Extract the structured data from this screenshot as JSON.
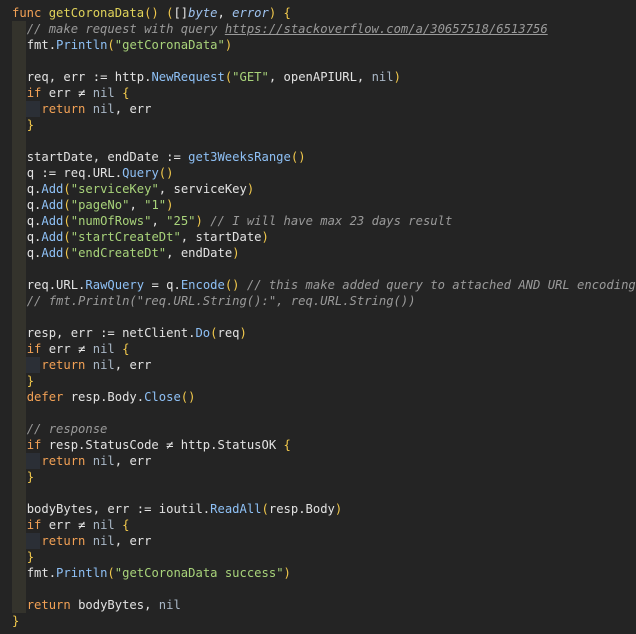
{
  "editor": {
    "language": "Go",
    "background": "#242424",
    "colors": {
      "keyword": "#f2a155",
      "function_name": "#e0d35a",
      "method_call": "#8ec0f5",
      "string": "#a8d37a",
      "comment": "#9a9a9a",
      "type": "#9fc3ef",
      "indent_guide_1": "#34332c",
      "indent_guide_2": "#2b2f36"
    },
    "lines": [
      {
        "indent": 0,
        "tokens": [
          [
            "kw",
            "func "
          ],
          [
            "fn",
            "getCoronaData"
          ],
          [
            "br",
            "() ("
          ],
          [
            "op",
            "[]"
          ],
          [
            "ty",
            "byte"
          ],
          [
            "op",
            ", "
          ],
          [
            "ty",
            "error"
          ],
          [
            "br",
            ") {"
          ]
        ]
      },
      {
        "indent": 1,
        "tokens": [
          [
            "cm",
            "// make request with query "
          ],
          [
            "url",
            "https://stackoverflow.com/a/30657518/6513756"
          ]
        ]
      },
      {
        "indent": 1,
        "tokens": [
          [
            "var",
            "fmt."
          ],
          [
            "call",
            "Println"
          ],
          [
            "br",
            "("
          ],
          [
            "str",
            "\"getCoronaData\""
          ],
          [
            "br",
            ")"
          ]
        ]
      },
      {
        "indent": 1,
        "tokens": []
      },
      {
        "indent": 1,
        "tokens": [
          [
            "var",
            "req, err "
          ],
          [
            "op",
            ":= "
          ],
          [
            "var",
            "http."
          ],
          [
            "call",
            "NewRequest"
          ],
          [
            "br",
            "("
          ],
          [
            "str",
            "\"GET\""
          ],
          [
            "op",
            ", "
          ],
          [
            "var",
            "openAPIURL, "
          ],
          [
            "nil",
            "nil"
          ],
          [
            "br",
            ")"
          ]
        ]
      },
      {
        "indent": 1,
        "tokens": [
          [
            "kw",
            "if "
          ],
          [
            "var",
            "err "
          ],
          [
            "op",
            "≠ "
          ],
          [
            "nil",
            "nil "
          ],
          [
            "br",
            "{"
          ]
        ]
      },
      {
        "indent": 2,
        "tokens": [
          [
            "kw",
            "return "
          ],
          [
            "nil",
            "nil"
          ],
          [
            "op",
            ", "
          ],
          [
            "var",
            "err"
          ]
        ]
      },
      {
        "indent": 1,
        "tokens": [
          [
            "br",
            "}"
          ]
        ]
      },
      {
        "indent": 1,
        "tokens": []
      },
      {
        "indent": 1,
        "tokens": [
          [
            "var",
            "startDate, endDate "
          ],
          [
            "op",
            ":= "
          ],
          [
            "call",
            "get3WeeksRange"
          ],
          [
            "br",
            "()"
          ]
        ]
      },
      {
        "indent": 1,
        "tokens": [
          [
            "var",
            "q "
          ],
          [
            "op",
            ":= "
          ],
          [
            "var",
            "req.URL."
          ],
          [
            "call",
            "Query"
          ],
          [
            "br",
            "()"
          ]
        ]
      },
      {
        "indent": 1,
        "tokens": [
          [
            "var",
            "q."
          ],
          [
            "call",
            "Add"
          ],
          [
            "br",
            "("
          ],
          [
            "str",
            "\"serviceKey\""
          ],
          [
            "op",
            ", "
          ],
          [
            "var",
            "serviceKey"
          ],
          [
            "br",
            ")"
          ]
        ]
      },
      {
        "indent": 1,
        "tokens": [
          [
            "var",
            "q."
          ],
          [
            "call",
            "Add"
          ],
          [
            "br",
            "("
          ],
          [
            "str",
            "\"pageNo\""
          ],
          [
            "op",
            ", "
          ],
          [
            "str",
            "\"1\""
          ],
          [
            "br",
            ")"
          ]
        ]
      },
      {
        "indent": 1,
        "tokens": [
          [
            "var",
            "q."
          ],
          [
            "call",
            "Add"
          ],
          [
            "br",
            "("
          ],
          [
            "str",
            "\"numOfRows\""
          ],
          [
            "op",
            ", "
          ],
          [
            "str",
            "\"25\""
          ],
          [
            "br",
            ") "
          ],
          [
            "cm",
            "// I will have max 23 days result"
          ]
        ]
      },
      {
        "indent": 1,
        "tokens": [
          [
            "var",
            "q."
          ],
          [
            "call",
            "Add"
          ],
          [
            "br",
            "("
          ],
          [
            "str",
            "\"startCreateDt\""
          ],
          [
            "op",
            ", "
          ],
          [
            "var",
            "startDate"
          ],
          [
            "br",
            ")"
          ]
        ]
      },
      {
        "indent": 1,
        "tokens": [
          [
            "var",
            "q."
          ],
          [
            "call",
            "Add"
          ],
          [
            "br",
            "("
          ],
          [
            "str",
            "\"endCreateDt\""
          ],
          [
            "op",
            ", "
          ],
          [
            "var",
            "endDate"
          ],
          [
            "br",
            ")"
          ]
        ]
      },
      {
        "indent": 1,
        "tokens": []
      },
      {
        "indent": 1,
        "tokens": [
          [
            "var",
            "req.URL."
          ],
          [
            "call",
            "RawQuery "
          ],
          [
            "op",
            "= "
          ],
          [
            "var",
            "q."
          ],
          [
            "call",
            "Encode"
          ],
          [
            "br",
            "() "
          ],
          [
            "cm",
            "// this make added query to attached AND URL encoding"
          ]
        ]
      },
      {
        "indent": 1,
        "tokens": [
          [
            "cm",
            "// fmt.Println(\"req.URL.String():\", req.URL.String())"
          ]
        ]
      },
      {
        "indent": 1,
        "tokens": []
      },
      {
        "indent": 1,
        "tokens": [
          [
            "var",
            "resp, err "
          ],
          [
            "op",
            ":= "
          ],
          [
            "var",
            "netClient."
          ],
          [
            "call",
            "Do"
          ],
          [
            "br",
            "("
          ],
          [
            "var",
            "req"
          ],
          [
            "br",
            ")"
          ]
        ]
      },
      {
        "indent": 1,
        "tokens": [
          [
            "kw",
            "if "
          ],
          [
            "var",
            "err "
          ],
          [
            "op",
            "≠ "
          ],
          [
            "nil",
            "nil "
          ],
          [
            "br",
            "{"
          ]
        ]
      },
      {
        "indent": 2,
        "tokens": [
          [
            "kw",
            "return "
          ],
          [
            "nil",
            "nil"
          ],
          [
            "op",
            ", "
          ],
          [
            "var",
            "err"
          ]
        ]
      },
      {
        "indent": 1,
        "tokens": [
          [
            "br",
            "}"
          ]
        ]
      },
      {
        "indent": 1,
        "tokens": [
          [
            "kw",
            "defer "
          ],
          [
            "var",
            "resp.Body."
          ],
          [
            "call",
            "Close"
          ],
          [
            "br",
            "()"
          ]
        ]
      },
      {
        "indent": 1,
        "tokens": []
      },
      {
        "indent": 1,
        "tokens": [
          [
            "cm",
            "// response"
          ]
        ]
      },
      {
        "indent": 1,
        "tokens": [
          [
            "kw",
            "if "
          ],
          [
            "var",
            "resp.StatusCode "
          ],
          [
            "op",
            "≠ "
          ],
          [
            "var",
            "http.StatusOK "
          ],
          [
            "br",
            "{"
          ]
        ]
      },
      {
        "indent": 2,
        "tokens": [
          [
            "kw",
            "return "
          ],
          [
            "nil",
            "nil"
          ],
          [
            "op",
            ", "
          ],
          [
            "var",
            "err"
          ]
        ]
      },
      {
        "indent": 1,
        "tokens": [
          [
            "br",
            "}"
          ]
        ]
      },
      {
        "indent": 1,
        "tokens": []
      },
      {
        "indent": 1,
        "tokens": [
          [
            "var",
            "bodyBytes, err "
          ],
          [
            "op",
            ":= "
          ],
          [
            "var",
            "ioutil."
          ],
          [
            "call",
            "ReadAll"
          ],
          [
            "br",
            "("
          ],
          [
            "var",
            "resp.Body"
          ],
          [
            "br",
            ")"
          ]
        ]
      },
      {
        "indent": 1,
        "tokens": [
          [
            "kw",
            "if "
          ],
          [
            "var",
            "err "
          ],
          [
            "op",
            "≠ "
          ],
          [
            "nil",
            "nil "
          ],
          [
            "br",
            "{"
          ]
        ]
      },
      {
        "indent": 2,
        "tokens": [
          [
            "kw",
            "return "
          ],
          [
            "nil",
            "nil"
          ],
          [
            "op",
            ", "
          ],
          [
            "var",
            "err"
          ]
        ]
      },
      {
        "indent": 1,
        "tokens": [
          [
            "br",
            "}"
          ]
        ]
      },
      {
        "indent": 1,
        "tokens": [
          [
            "var",
            "fmt."
          ],
          [
            "call",
            "Println"
          ],
          [
            "br",
            "("
          ],
          [
            "str",
            "\"getCoronaData success\""
          ],
          [
            "br",
            ")"
          ]
        ]
      },
      {
        "indent": 1,
        "tokens": []
      },
      {
        "indent": 1,
        "tokens": [
          [
            "kw",
            "return "
          ],
          [
            "var",
            "bodyBytes, "
          ],
          [
            "nil",
            "nil"
          ]
        ]
      },
      {
        "indent": 0,
        "tokens": [
          [
            "br",
            "}"
          ]
        ]
      }
    ]
  }
}
